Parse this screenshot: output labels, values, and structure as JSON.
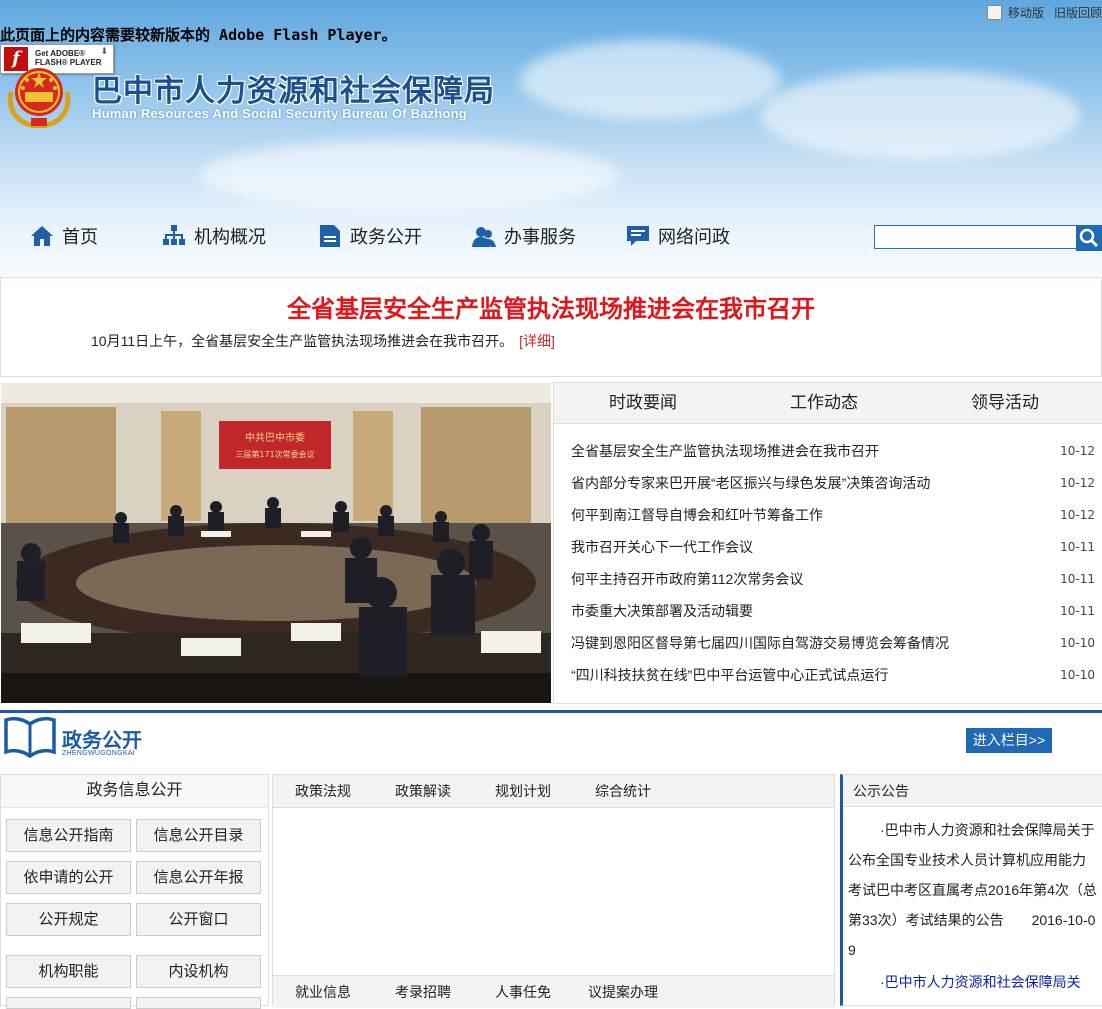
{
  "flash": {
    "message": "此页面上的内容需要较新版本的 Adobe Flash Player。",
    "badge_line1": "Get ADOBE®",
    "badge_line2": "FLASH® PLAYER"
  },
  "top_links": {
    "mobile": "移动版",
    "old": "旧版回顾"
  },
  "site": {
    "title": "巴中市人力资源和社会保障局",
    "subtitle": "Human Resources And Social Security Bureau Of Bazhong"
  },
  "nav": [
    {
      "label": "首页",
      "icon": "home-icon"
    },
    {
      "label": "机构概况",
      "icon": "org-chart-icon"
    },
    {
      "label": "政务公开",
      "icon": "document-icon"
    },
    {
      "label": "办事服务",
      "icon": "people-icon"
    },
    {
      "label": "网络问政",
      "icon": "chat-icon"
    }
  ],
  "search": {
    "placeholder": "",
    "icon": "search-icon"
  },
  "headline": {
    "title": "全省基层安全生产监管执法现场推进会在我市召开",
    "summary": "10月11日上午，全省基层安全生产监管执法现场推进会在我市召开。",
    "more": "[详细]"
  },
  "photo": {
    "banner_text_1": "中共巴中市委",
    "banner_text_2": "三届第171次常委会议"
  },
  "news": {
    "tabs": [
      "时政要闻",
      "工作动态",
      "领导活动"
    ],
    "items": [
      {
        "title": "全省基层安全生产监管执法现场推进会在我市召开",
        "date": "10-12"
      },
      {
        "title": "省内部分专家来巴开展“老区振兴与绿色发展”决策咨询活动",
        "date": "10-12"
      },
      {
        "title": "何平到南江督导自博会和红叶节筹备工作",
        "date": "10-12"
      },
      {
        "title": "我市召开关心下一代工作会议",
        "date": "10-11"
      },
      {
        "title": "何平主持召开市政府第112次常务会议",
        "date": "10-11"
      },
      {
        "title": "市委重大决策部署及活动辑要",
        "date": "10-11"
      },
      {
        "title": "冯键到恩阳区督导第七届四川国际自驾游交易博览会筹备情况",
        "date": "10-10"
      },
      {
        "title": "“四川科技扶贫在线”巴中平台运管中心正式试点运行",
        "date": "10-10"
      }
    ]
  },
  "section": {
    "title": "政务公开",
    "pinyin": "ZHENGWUGONGKAI",
    "enter": "进入栏目>>"
  },
  "gov_info": {
    "title": "政务信息公开",
    "buttons": [
      "信息公开指南",
      "信息公开目录",
      "依申请的公开",
      "信息公开年报",
      "公开规定",
      "公开窗口",
      "机构职能",
      "内设机构"
    ]
  },
  "policy": {
    "tabs": [
      "政策法规",
      "政策解读",
      "规划计划",
      "综合统计"
    ],
    "tabs2": [
      "就业信息",
      "考录招聘",
      "人事任免",
      "议提案办理"
    ]
  },
  "notice": {
    "title": "公示公告",
    "items": [
      {
        "text": "·巴中市人力资源和社会保障局关于公布全国专业技术人员计算机应用能力考试巴中考区直属考点2016年第4次（总第33次）考试结果的公告",
        "date": "2016-10-09"
      },
      {
        "text": "·巴中市人力资源和社会保障局关"
      }
    ]
  },
  "colors": {
    "accent": "#1a5aa6",
    "headline_red": "#e0161b"
  }
}
